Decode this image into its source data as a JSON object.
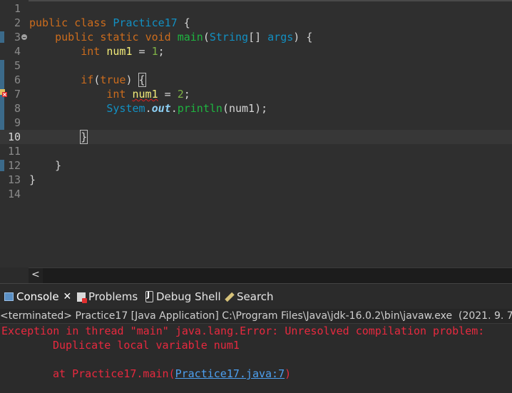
{
  "editor": {
    "lines": [
      {
        "n": "1",
        "tokens": []
      },
      {
        "n": "2",
        "tokens": [
          [
            "kw",
            "public"
          ],
          [
            "p",
            " "
          ],
          [
            "kw",
            "class"
          ],
          [
            "p",
            " "
          ],
          [
            "cls",
            "Practice17"
          ],
          [
            "p",
            " {"
          ]
        ]
      },
      {
        "n": "3",
        "tokens": [
          [
            "p",
            "    "
          ],
          [
            "kw",
            "public"
          ],
          [
            "p",
            " "
          ],
          [
            "kw",
            "static"
          ],
          [
            "p",
            " "
          ],
          [
            "kw",
            "void"
          ],
          [
            "p",
            " "
          ],
          [
            "mth",
            "main"
          ],
          [
            "p",
            "("
          ],
          [
            "cls",
            "String"
          ],
          [
            "p",
            "[] "
          ],
          [
            "cls",
            "args"
          ],
          [
            "p",
            ") {"
          ]
        ]
      },
      {
        "n": "4",
        "tokens": [
          [
            "p",
            "        "
          ],
          [
            "kw",
            "int"
          ],
          [
            "p",
            " "
          ],
          [
            "var",
            "num1"
          ],
          [
            "p",
            " = "
          ],
          [
            "num",
            "1"
          ],
          [
            "p",
            ";"
          ]
        ]
      },
      {
        "n": "5",
        "tokens": []
      },
      {
        "n": "6",
        "tokens": [
          [
            "p",
            "        "
          ],
          [
            "kw",
            "if"
          ],
          [
            "p",
            "("
          ],
          [
            "kw",
            "true"
          ],
          [
            "p",
            ") "
          ],
          [
            "bracket",
            "{"
          ]
        ]
      },
      {
        "n": "7",
        "tokens": [
          [
            "p",
            "            "
          ],
          [
            "kw",
            "int"
          ],
          [
            "p",
            " "
          ],
          [
            "errvar",
            "num1"
          ],
          [
            "p",
            " = "
          ],
          [
            "num",
            "2"
          ],
          [
            "p",
            ";"
          ]
        ]
      },
      {
        "n": "8",
        "tokens": [
          [
            "p",
            "            "
          ],
          [
            "cls",
            "System"
          ],
          [
            "p",
            "."
          ],
          [
            "fld",
            "out"
          ],
          [
            "p",
            "."
          ],
          [
            "mth",
            "println"
          ],
          [
            "p",
            "(num1);"
          ]
        ]
      },
      {
        "n": "9",
        "tokens": []
      },
      {
        "n": "10",
        "tokens": [
          [
            "p",
            "        "
          ],
          [
            "bracket",
            "}"
          ],
          [
            "caret",
            ""
          ]
        ]
      },
      {
        "n": "11",
        "tokens": []
      },
      {
        "n": "12",
        "tokens": [
          [
            "p",
            "    }"
          ]
        ]
      },
      {
        "n": "13",
        "tokens": [
          [
            "p",
            "}"
          ]
        ]
      },
      {
        "n": "14",
        "tokens": []
      }
    ],
    "scroll_left_arrow": "<"
  },
  "tabs": [
    {
      "icon": "console-icon",
      "label": "Console",
      "active": true,
      "close": "✕"
    },
    {
      "icon": "problems-icon",
      "label": "Problems"
    },
    {
      "icon": "debug-shell-icon",
      "label": "Debug Shell"
    },
    {
      "icon": "search-icon",
      "label": "Search"
    }
  ],
  "console": {
    "status": "<terminated> Practice17 [Java Application] C:\\Program Files\\Java\\jdk-16.0.2\\bin\\javaw.exe  (2021. 9. 7",
    "error_line1": "Exception in thread \"main\" java.lang.Error: Unresolved compilation problem: ",
    "error_line2": "\tDuplicate local variable num1",
    "error_line3_prefix": "\tat Practice17.main(",
    "error_link": "Practice17.java:7",
    "error_line3_suffix": ")"
  },
  "colors": {
    "keyword": "#cc6c1d",
    "class": "#1290c3",
    "method": "#1eb540",
    "variable": "#f3ec79",
    "number": "#7fb347",
    "error_text": "#e8293f",
    "link": "#4da0f0"
  }
}
